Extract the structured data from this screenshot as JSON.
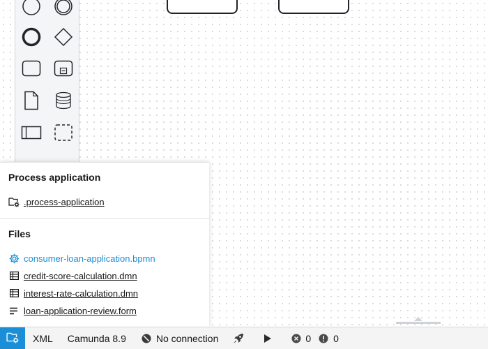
{
  "popup": {
    "process_application_title": "Process application",
    "process_application_file": ".process-application",
    "files_title": "Files",
    "files": [
      {
        "name": "consumer-loan-application.bpmn",
        "icon": "gear-icon",
        "active": true
      },
      {
        "name": "credit-score-calculation.dmn",
        "icon": "table-icon",
        "active": false
      },
      {
        "name": "interest-rate-calculation.dmn",
        "icon": "table-icon",
        "active": false
      },
      {
        "name": "loan-application-review.form",
        "icon": "form-icon",
        "active": false
      }
    ]
  },
  "statusbar": {
    "xml_label": "XML",
    "engine_label": "Camunda 8.9",
    "connection_label": "No connection",
    "errors_count": "0",
    "warnings_count": "0"
  },
  "colors": {
    "accent": "#1a8ed6"
  },
  "palette": {
    "tools": [
      "start-event-icon",
      "intermediate-event-icon",
      "end-event-icon",
      "gateway-icon",
      "task-icon",
      "subprocess-icon",
      "data-object-icon",
      "data-store-icon",
      "pool-icon",
      "group-icon"
    ]
  }
}
